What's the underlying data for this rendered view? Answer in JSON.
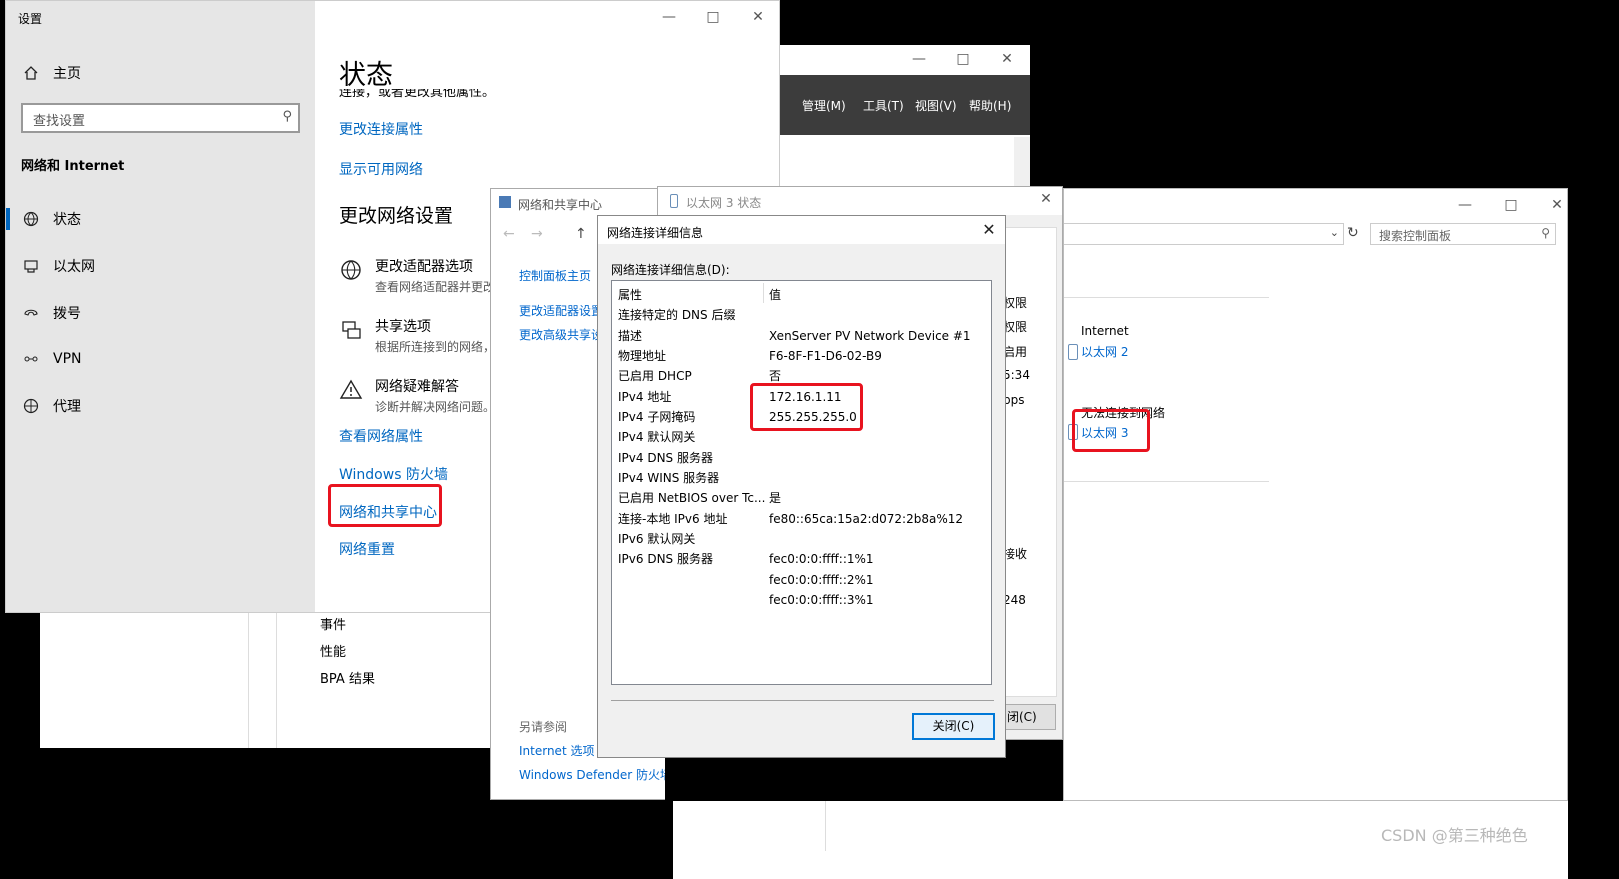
{
  "settings": {
    "title": "设置",
    "home": "主页",
    "search_placeholder": "查找设置",
    "section": "网络和 Internet",
    "nav": [
      "状态",
      "以太网",
      "拨号",
      "VPN",
      "代理"
    ],
    "page_title": "状态",
    "clipped_text": "连接，或者更改其他属性。",
    "change_conn_props": "更改连接属性",
    "show_networks": "显示可用网络",
    "change_settings_heading": "更改网络设置",
    "options": [
      {
        "title": "更改适配器选项",
        "desc": "查看网络适配器并更改"
      },
      {
        "title": "共享选项",
        "desc": "根据所连接到的网络，"
      },
      {
        "title": "网络疑难解答",
        "desc": "诊断并解决网络问题。"
      }
    ],
    "links": [
      "查看网络属性",
      "Windows 防火墙",
      "网络和共享中心",
      "网络重置"
    ]
  },
  "server_manager": {
    "menus": [
      "管理(M)",
      "工具(T)",
      "视图(V)",
      "帮助(H)"
    ],
    "items": [
      "事件",
      "性能",
      "BPA 结果"
    ]
  },
  "nsc": {
    "title": "网络和共享中心",
    "left_links": [
      "控制面板主页",
      "更改适配器设置",
      "更改高级共享设"
    ],
    "see_also": "另请参阅",
    "see_also_links": [
      "Internet 选项",
      "Windows Defender 防火墙"
    ]
  },
  "eth_status": {
    "title": "以太网 3 状态",
    "right_fragments": [
      "权限",
      "权限",
      "启用",
      "5:34",
      "bps",
      "接收",
      "248"
    ],
    "close_fragment": "闭(C)"
  },
  "control_panel": {
    "search_placeholder": "搜索控制面板",
    "internet_label": "Internet",
    "eth2": "以太网 2",
    "no_connect": "无法连接到网络",
    "eth3": "以太网 3"
  },
  "details": {
    "title": "网络连接详细信息",
    "list_label": "网络连接详细信息(D):",
    "col_property": "属性",
    "col_value": "值",
    "rows": [
      {
        "p": "连接特定的 DNS 后缀",
        "v": ""
      },
      {
        "p": "描述",
        "v": "XenServer PV Network Device #1"
      },
      {
        "p": "物理地址",
        "v": "F6-8F-F1-D6-02-B9"
      },
      {
        "p": "已启用 DHCP",
        "v": "否"
      },
      {
        "p": "IPv4 地址",
        "v": "172.16.1.11"
      },
      {
        "p": "IPv4 子网掩码",
        "v": "255.255.255.0"
      },
      {
        "p": "IPv4 默认网关",
        "v": ""
      },
      {
        "p": "IPv4 DNS 服务器",
        "v": ""
      },
      {
        "p": "IPv4 WINS 服务器",
        "v": ""
      },
      {
        "p": "已启用 NetBIOS over Tc...",
        "v": "是"
      },
      {
        "p": "连接-本地 IPv6 地址",
        "v": "fe80::65ca:15a2:d072:2b8a%12"
      },
      {
        "p": "IPv6 默认网关",
        "v": ""
      },
      {
        "p": "IPv6 DNS 服务器",
        "v": "fec0:0:0:ffff::1%1"
      },
      {
        "p": "",
        "v": "fec0:0:0:ffff::2%1"
      },
      {
        "p": "",
        "v": "fec0:0:0:ffff::3%1"
      }
    ],
    "close_button": "关闭(C)"
  },
  "watermark": "CSDN @第三种绝色"
}
